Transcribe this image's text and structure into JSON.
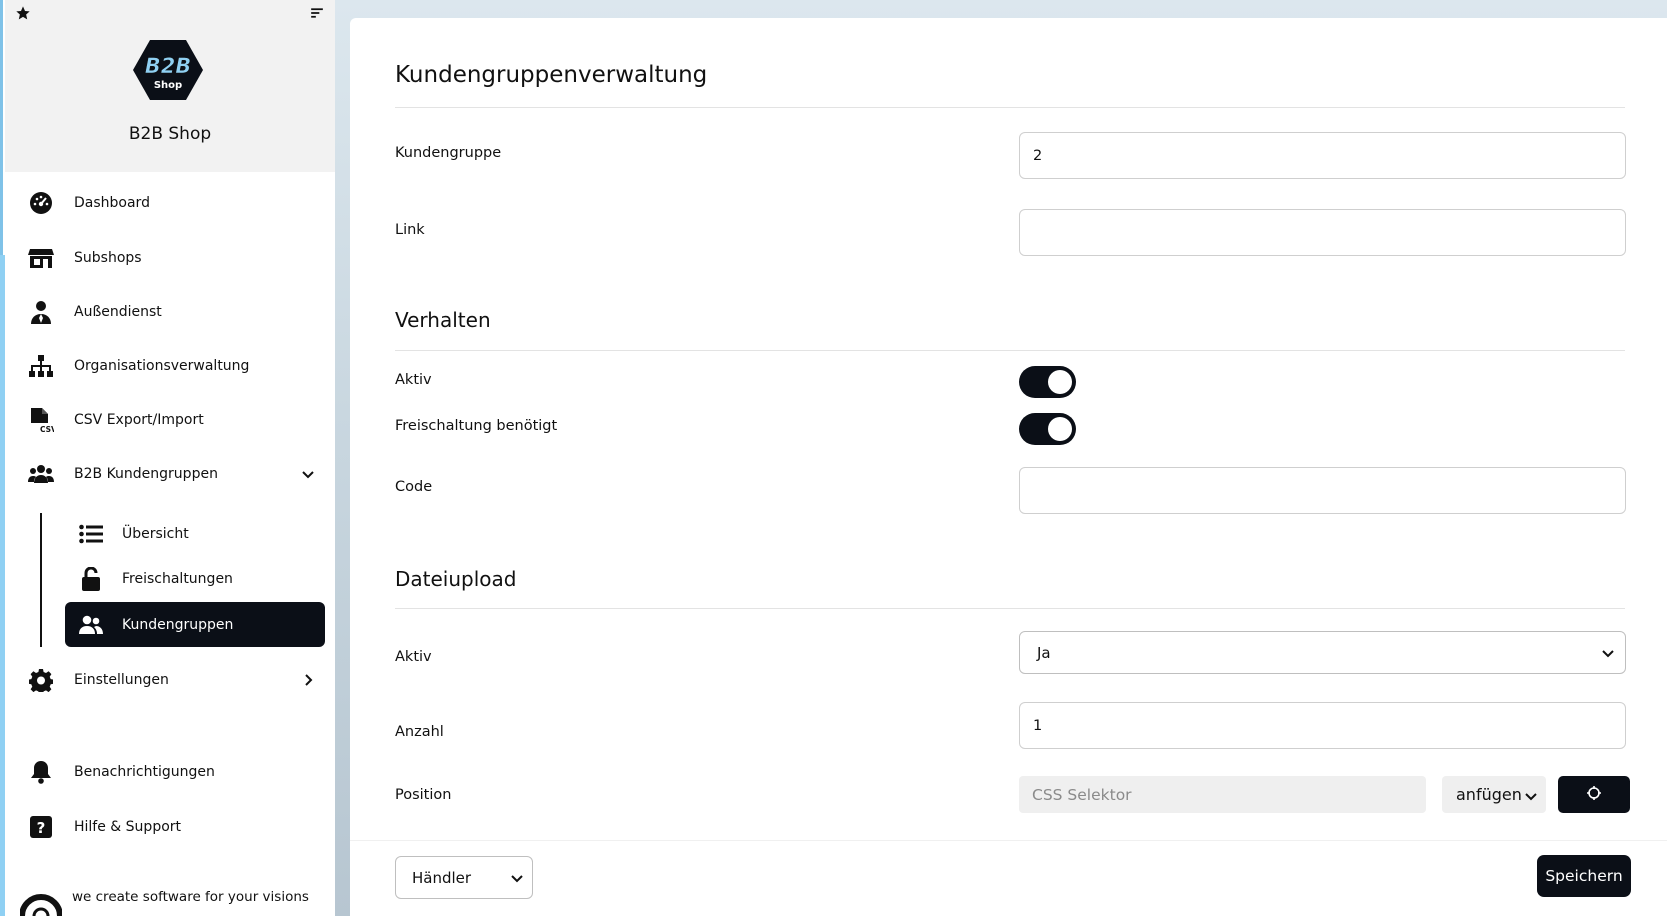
{
  "sidebar": {
    "shop_name": "B2B Shop",
    "logo": {
      "line1": "B2B",
      "line2": "Shop"
    },
    "header_icons": [
      "star-icon",
      "sort-icon"
    ],
    "items": [
      {
        "label": "Dashboard",
        "icon": "speedometer-icon"
      },
      {
        "label": "Subshops",
        "icon": "store-icon"
      },
      {
        "label": "Außendienst",
        "icon": "user-tie-icon"
      },
      {
        "label": "Organisationsverwaltung",
        "icon": "sitemap-icon"
      },
      {
        "label": "CSV Export/Import",
        "icon": "csv-file-icon"
      },
      {
        "label": "B2B Kundengruppen",
        "icon": "users-icon",
        "expanded": true
      },
      {
        "label": "Einstellungen",
        "icon": "gear-icon",
        "expanded": false
      },
      {
        "label": "Benachrichtigungen",
        "icon": "bell-icon"
      },
      {
        "label": "Hilfe & Support",
        "icon": "question-icon"
      }
    ],
    "sub_items": [
      {
        "label": "Übersicht",
        "icon": "list-icon"
      },
      {
        "label": "Freischaltungen",
        "icon": "unlock-icon"
      },
      {
        "label": "Kundengruppen",
        "icon": "users-icon",
        "active": true
      }
    ],
    "footer_text": "we create software for your visions"
  },
  "main": {
    "title": "Kundengruppenverwaltung",
    "fields": {
      "kundengruppe": {
        "label": "Kundengruppe",
        "value": "2"
      },
      "link": {
        "label": "Link",
        "value": ""
      }
    },
    "verhalten": {
      "heading": "Verhalten",
      "aktiv": {
        "label": "Aktiv",
        "on": true
      },
      "freischaltung": {
        "label": "Freischaltung benötigt",
        "on": true
      },
      "code": {
        "label": "Code",
        "value": ""
      }
    },
    "dateiupload": {
      "heading": "Dateiupload",
      "aktiv": {
        "label": "Aktiv",
        "selected": "Ja"
      },
      "anzahl": {
        "label": "Anzahl",
        "value": "1"
      },
      "position": {
        "label": "Position",
        "selector_placeholder": "CSS Selektor",
        "mode_selected": "anfügen",
        "target_icon": "crosshair-icon"
      }
    },
    "bottom": {
      "role_selected": "Händler",
      "save_label": "Speichern"
    }
  },
  "colors": {
    "dark": "#0b0f17",
    "sidebar_accent": "#8fd0f3",
    "header_bg": "#f2f2f2"
  }
}
